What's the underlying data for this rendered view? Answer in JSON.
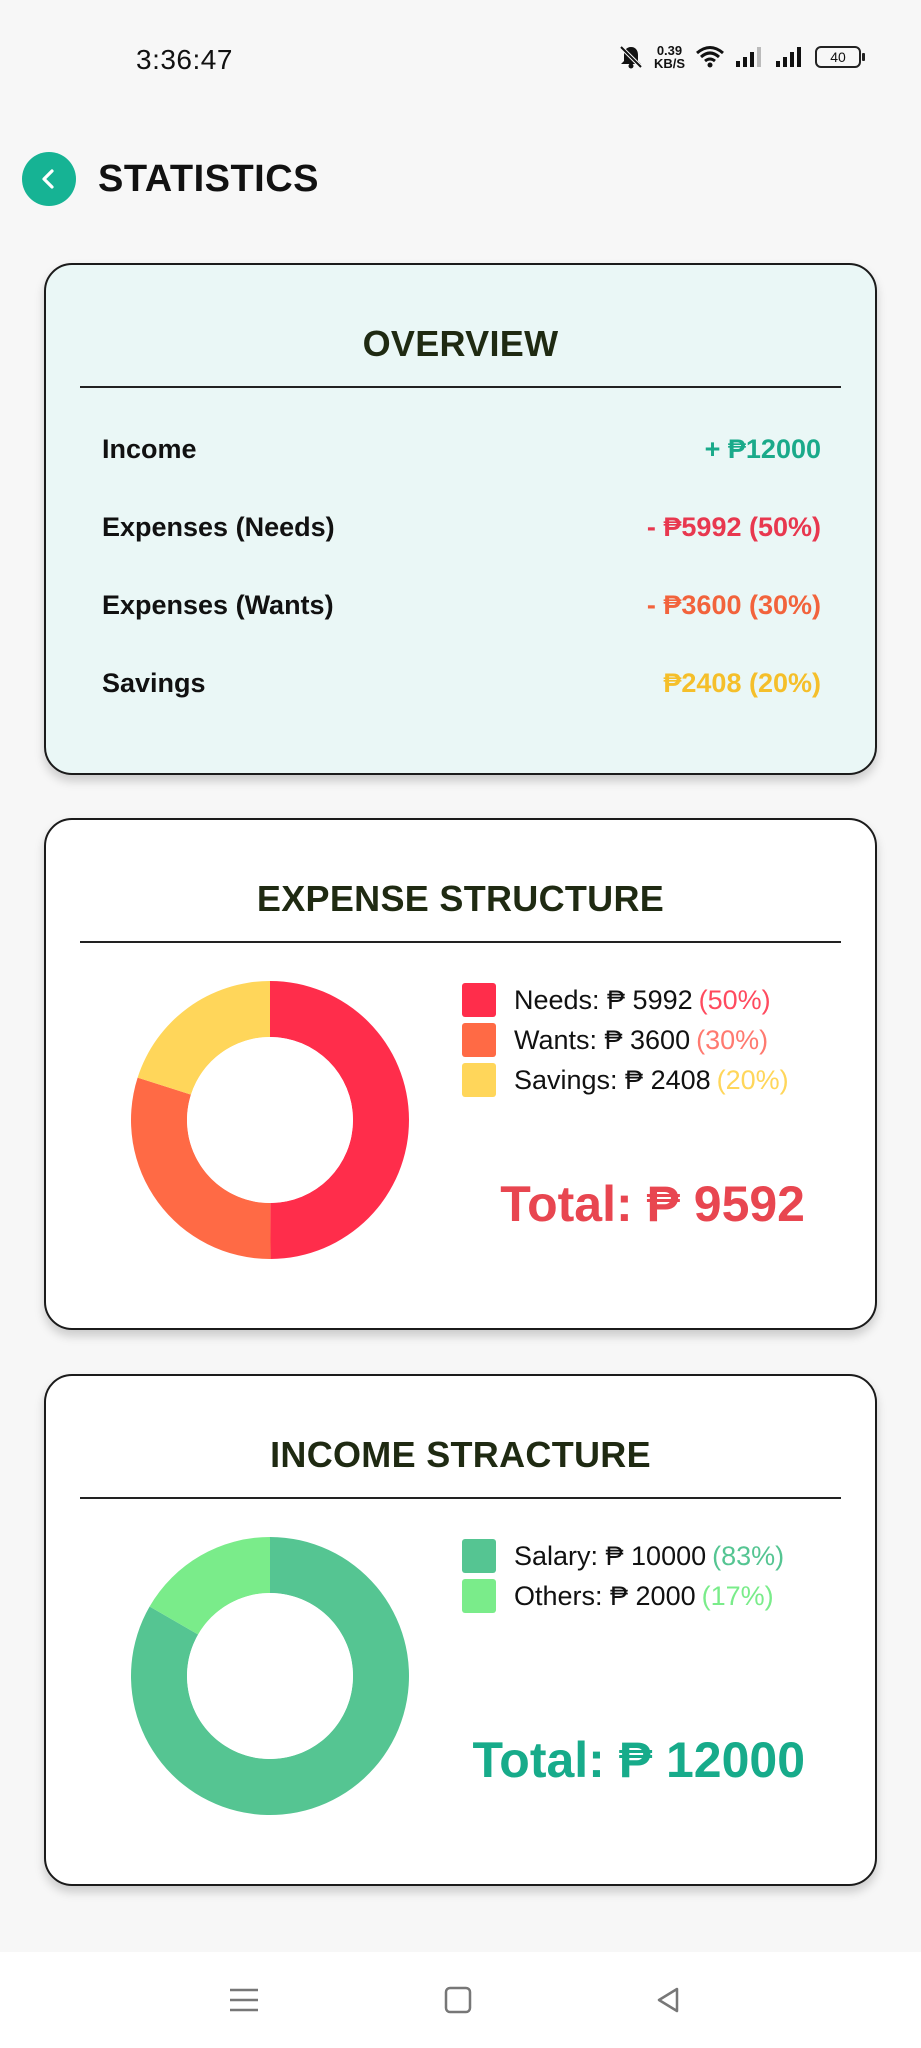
{
  "status_bar": {
    "time": "3:36:47",
    "net_speed_value": "0.39",
    "net_speed_unit": "KB/S",
    "battery": "40"
  },
  "header": {
    "title": "STATISTICS"
  },
  "overview": {
    "title": "OVERVIEW",
    "rows": [
      {
        "label": "Income",
        "value": "+ ₱12000",
        "color": "#1aaa8a"
      },
      {
        "label": "Expenses (Needs)",
        "value": "- ₱5992 (50%)",
        "color": "#e8384f"
      },
      {
        "label": "Expenses (Wants)",
        "value": "- ₱3600 (30%)",
        "color": "#f2633c"
      },
      {
        "label": "Savings",
        "value": "₱2408 (20%)",
        "color": "#f5bf2a"
      }
    ]
  },
  "expense_structure": {
    "title": "EXPENSE STRUCTURE",
    "legend": [
      {
        "label": "Needs: ₱ 5992",
        "pct": "(50%)",
        "color": "#ff2d4b"
      },
      {
        "label": "Wants: ₱ 3600",
        "pct": "(30%)",
        "color": "#ff6a45"
      },
      {
        "label": "Savings: ₱ 2408",
        "pct": "(20%)",
        "color": "#ffd65a"
      }
    ],
    "total": "Total: ₱ 9592",
    "chart_data": {
      "type": "pie",
      "categories": [
        "Needs",
        "Wants",
        "Savings"
      ],
      "values": [
        5992,
        3600,
        2408
      ],
      "colors": [
        "#ff2d4b",
        "#ff6a45",
        "#ffd65a"
      ]
    }
  },
  "income_structure": {
    "title": "INCOME STRACTURE",
    "legend": [
      {
        "label": "Salary: ₱ 10000",
        "pct": "(83%)",
        "color": "#55c592"
      },
      {
        "label": "Others: ₱ 2000",
        "pct": "(17%)",
        "color": "#7aec8a"
      }
    ],
    "total": "Total: ₱ 12000",
    "chart_data": {
      "type": "pie",
      "categories": [
        "Salary",
        "Others"
      ],
      "values": [
        10000,
        2000
      ],
      "colors": [
        "#55c592",
        "#7aec8a"
      ]
    }
  },
  "chart_data": [
    {
      "type": "pie",
      "categories": [
        "Needs",
        "Wants",
        "Savings"
      ],
      "values": [
        5992,
        3600,
        2408
      ]
    },
    {
      "type": "pie",
      "categories": [
        "Salary",
        "Others"
      ],
      "values": [
        10000,
        2000
      ]
    }
  ]
}
